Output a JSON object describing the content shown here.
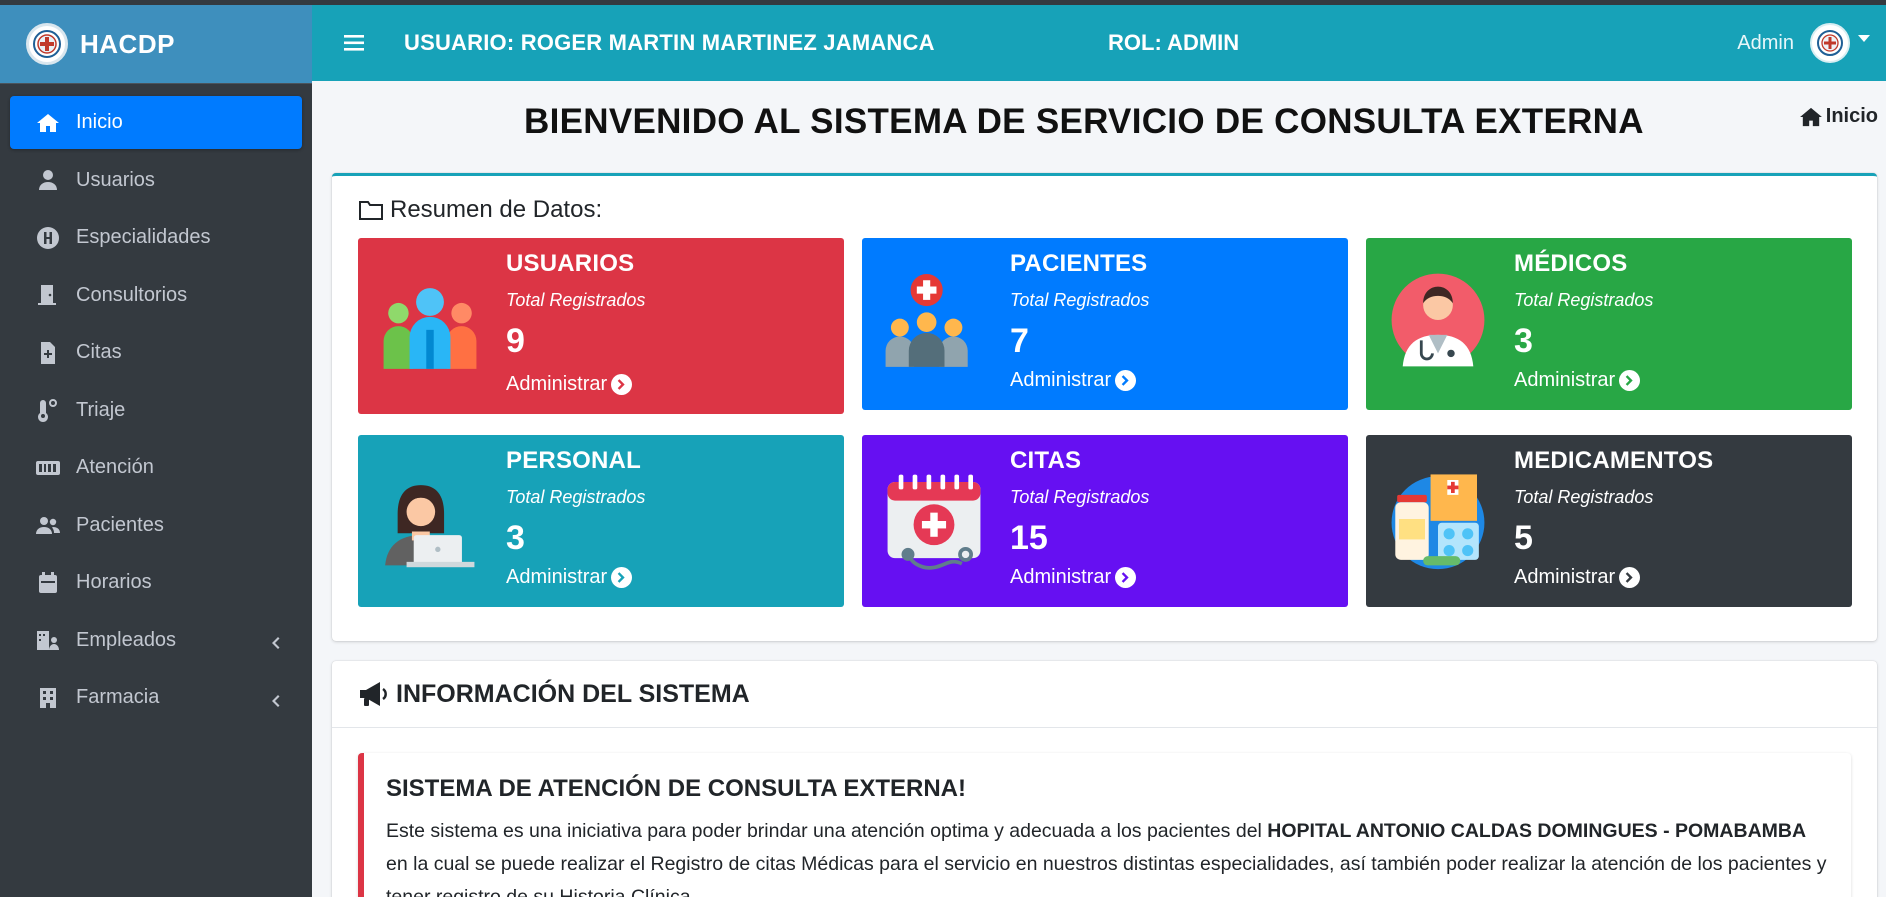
{
  "brand": {
    "name": "HACDP",
    "logo_icon": "hospital-logo-icon"
  },
  "sidebar": {
    "items": [
      {
        "label": "Inicio",
        "icon": "home-icon",
        "active": true
      },
      {
        "label": "Usuarios",
        "icon": "user-icon"
      },
      {
        "label": "Especialidades",
        "icon": "h-circle-icon"
      },
      {
        "label": "Consultorios",
        "icon": "door-icon"
      },
      {
        "label": "Citas",
        "icon": "file-medical-icon"
      },
      {
        "label": "Triaje",
        "icon": "thermometer-icon"
      },
      {
        "label": "Atención",
        "icon": "id-card-icon"
      },
      {
        "label": "Pacientes",
        "icon": "users-icon"
      },
      {
        "label": "Horarios",
        "icon": "calendar-icon"
      },
      {
        "label": "Empleados",
        "icon": "building-users-icon",
        "has_submenu": true
      },
      {
        "label": "Farmacia",
        "icon": "building-icon",
        "has_submenu": true
      }
    ]
  },
  "header": {
    "user": "USUARIO: ROGER MARTIN MARTINEZ JAMANCA",
    "role": "ROL: ADMIN",
    "admin_name": "Admin",
    "colors": {
      "bar": "#17a2b8",
      "brand": "#3e8fbd"
    }
  },
  "content": {
    "title": "BIENVENIDO AL SISTEMA DE SERVICIO DE CONSULTA EXTERNA",
    "breadcrumb": "Inicio"
  },
  "summary": {
    "heading": "Resumen de Datos:",
    "boxes": [
      {
        "title": "USUARIOS",
        "subtitle": "Total Registrados",
        "count": "9",
        "link": "Administrar",
        "color": "#dc3545",
        "icon": "users-group-icon"
      },
      {
        "title": "PACIENTES",
        "subtitle": "Total Registrados",
        "count": "7",
        "link": "Administrar",
        "color": "#007bff",
        "icon": "patients-cross-icon"
      },
      {
        "title": "MÉDICOS",
        "subtitle": "Total Registrados",
        "count": "3",
        "link": "Administrar",
        "color": "#28a745",
        "icon": "doctor-icon"
      },
      {
        "title": "PERSONAL",
        "subtitle": "Total Registrados",
        "count": "3",
        "link": "Administrar",
        "color": "#17a2b8",
        "icon": "staff-laptop-icon"
      },
      {
        "title": "CITAS",
        "subtitle": "Total Registrados",
        "count": "15",
        "link": "Administrar",
        "color": "#6610f2",
        "icon": "calendar-medical-icon"
      },
      {
        "title": "MEDICAMENTOS",
        "subtitle": "Total Registrados",
        "count": "5",
        "link": "Administrar",
        "color": "#343a40",
        "icon": "medicines-icon"
      }
    ]
  },
  "info": {
    "heading": "INFORMACIÓN DEL SISTEMA",
    "callout_title": "SISTEMA DE ATENCIÓN DE CONSULTA EXTERNA!",
    "text_part1": "Este sistema es una iniciativa para poder brindar una atención optima y adecuada a los pacientes del ",
    "text_bold": "HOPITAL ANTONIO CALDAS DOMINGUES - POMABAMBA",
    "text_part2": " en la cual se puede realizar el Registro de citas Médicas para el servicio en nuestros distintas especialidades, así también poder realizar la atención de los pacientes y tener registro de su Historia Clínica."
  }
}
